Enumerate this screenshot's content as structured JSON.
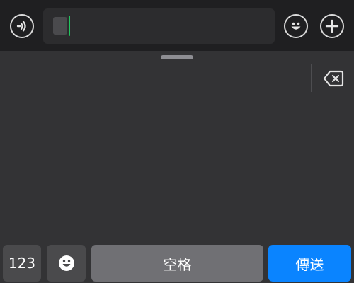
{
  "input": {
    "value": ""
  },
  "keyboard": {
    "numbers_label": "123",
    "space_label": "空格",
    "send_label": "傳送"
  },
  "icons": {
    "voice": "voice-icon",
    "emoji": "emoji-icon",
    "add": "plus-icon",
    "backspace": "backspace-icon",
    "emoji_key": "emoji-icon"
  },
  "colors": {
    "send_button": "#0a84ff",
    "caret": "#22c55e"
  }
}
